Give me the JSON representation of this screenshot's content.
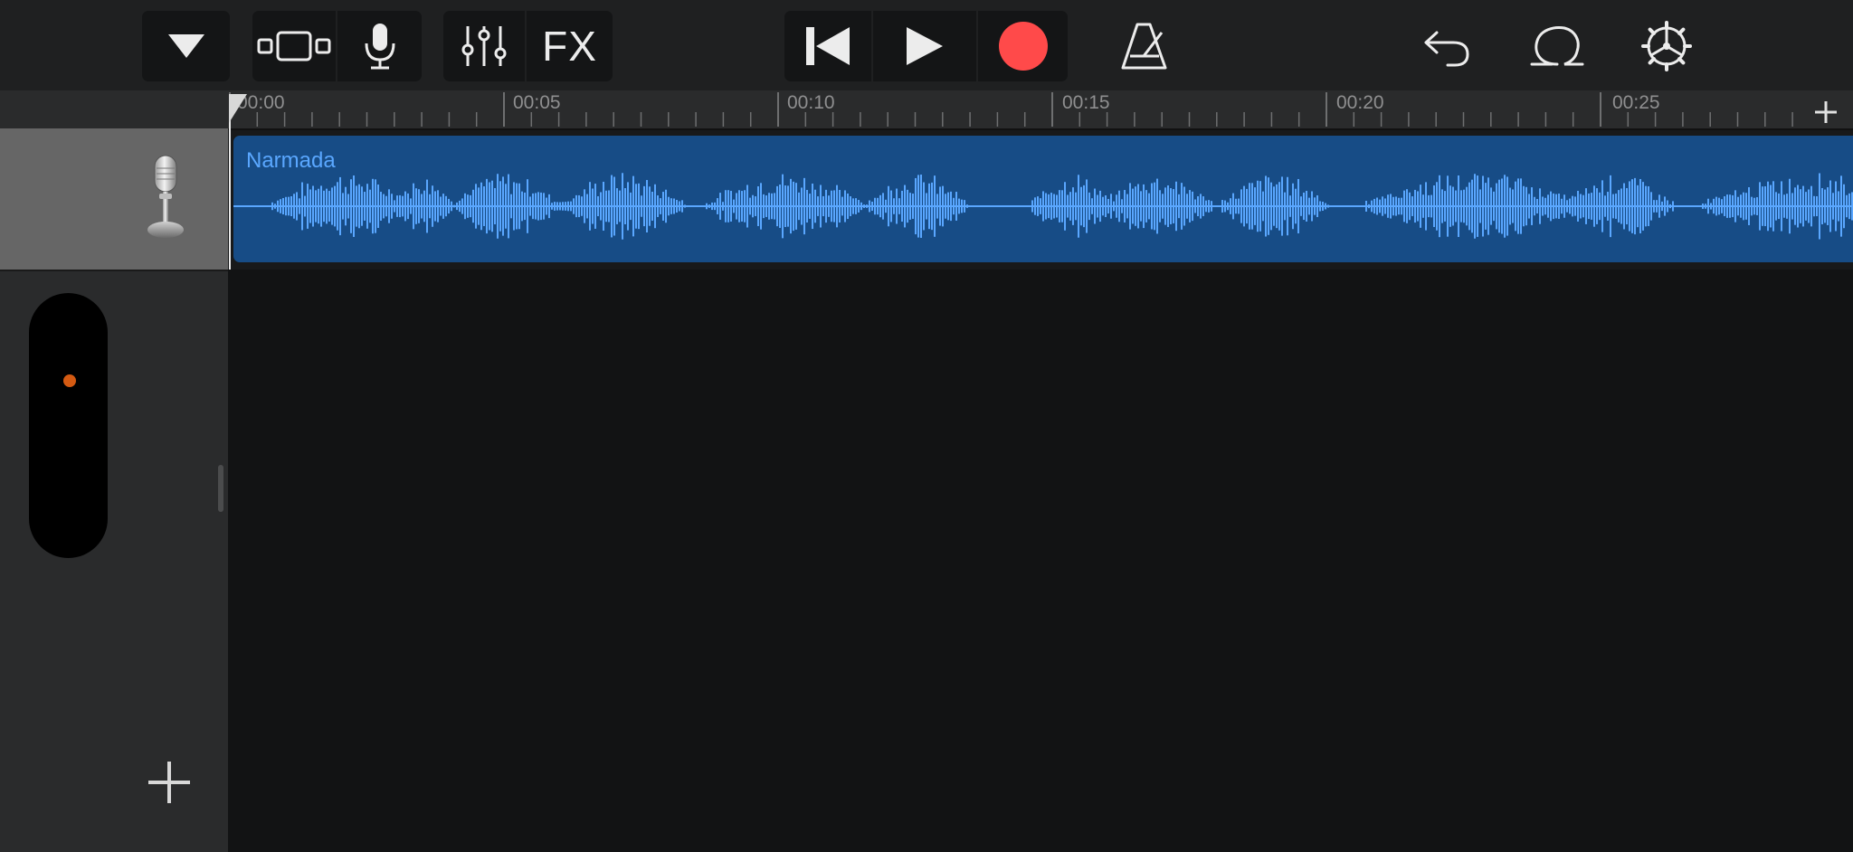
{
  "toolbar": {
    "fx_label": "FX"
  },
  "ruler": {
    "labels": [
      "00:00",
      "00:05",
      "00:10",
      "00:15",
      "00:20",
      "00:25"
    ]
  },
  "track": {
    "instrument_icon": "microphone-icon",
    "region_name": "Narmada"
  },
  "colors": {
    "background": "#1f2021",
    "region": "#174c86",
    "waveform": "#5aa7ff",
    "record": "#ff4a4a",
    "volume_dot": "#d45a12"
  }
}
